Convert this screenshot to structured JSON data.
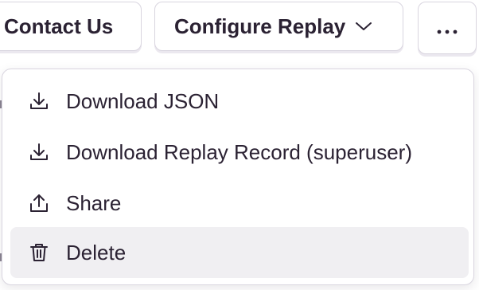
{
  "toolbar": {
    "contact_label": "Contact Us",
    "configure_label": "Configure Replay",
    "more_label": "..."
  },
  "menu": {
    "items": [
      {
        "label": "Download JSON",
        "icon": "download-icon"
      },
      {
        "label": "Download Replay Record (superuser)",
        "icon": "download-icon"
      },
      {
        "label": "Share",
        "icon": "share-icon"
      },
      {
        "label": "Delete",
        "icon": "trash-icon",
        "highlighted": true
      }
    ]
  },
  "colors": {
    "text": "#2b2233",
    "border": "#d9d5df",
    "hover_background": "#f0eff2",
    "background": "#ffffff"
  }
}
